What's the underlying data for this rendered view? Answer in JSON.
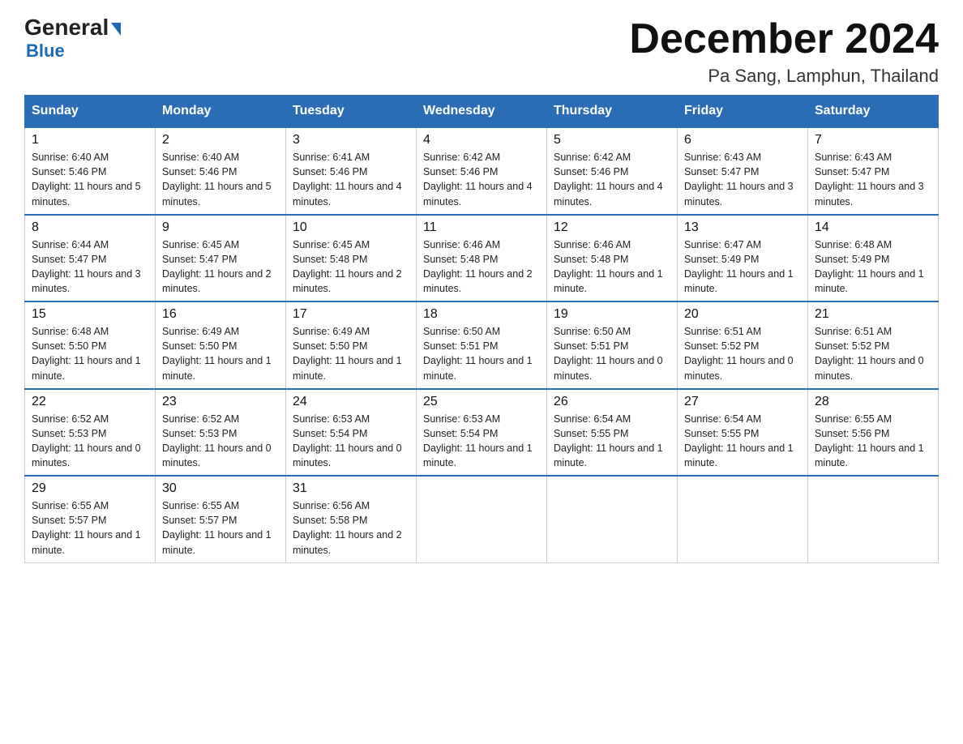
{
  "logo": {
    "general": "General",
    "blue": "Blue",
    "arrow": "▶"
  },
  "header": {
    "month": "December 2024",
    "location": "Pa Sang, Lamphun, Thailand"
  },
  "days": [
    "Sunday",
    "Monday",
    "Tuesday",
    "Wednesday",
    "Thursday",
    "Friday",
    "Saturday"
  ],
  "weeks": [
    [
      {
        "num": "1",
        "sunrise": "6:40 AM",
        "sunset": "5:46 PM",
        "daylight": "11 hours and 5 minutes."
      },
      {
        "num": "2",
        "sunrise": "6:40 AM",
        "sunset": "5:46 PM",
        "daylight": "11 hours and 5 minutes."
      },
      {
        "num": "3",
        "sunrise": "6:41 AM",
        "sunset": "5:46 PM",
        "daylight": "11 hours and 4 minutes."
      },
      {
        "num": "4",
        "sunrise": "6:42 AM",
        "sunset": "5:46 PM",
        "daylight": "11 hours and 4 minutes."
      },
      {
        "num": "5",
        "sunrise": "6:42 AM",
        "sunset": "5:46 PM",
        "daylight": "11 hours and 4 minutes."
      },
      {
        "num": "6",
        "sunrise": "6:43 AM",
        "sunset": "5:47 PM",
        "daylight": "11 hours and 3 minutes."
      },
      {
        "num": "7",
        "sunrise": "6:43 AM",
        "sunset": "5:47 PM",
        "daylight": "11 hours and 3 minutes."
      }
    ],
    [
      {
        "num": "8",
        "sunrise": "6:44 AM",
        "sunset": "5:47 PM",
        "daylight": "11 hours and 3 minutes."
      },
      {
        "num": "9",
        "sunrise": "6:45 AM",
        "sunset": "5:47 PM",
        "daylight": "11 hours and 2 minutes."
      },
      {
        "num": "10",
        "sunrise": "6:45 AM",
        "sunset": "5:48 PM",
        "daylight": "11 hours and 2 minutes."
      },
      {
        "num": "11",
        "sunrise": "6:46 AM",
        "sunset": "5:48 PM",
        "daylight": "11 hours and 2 minutes."
      },
      {
        "num": "12",
        "sunrise": "6:46 AM",
        "sunset": "5:48 PM",
        "daylight": "11 hours and 1 minute."
      },
      {
        "num": "13",
        "sunrise": "6:47 AM",
        "sunset": "5:49 PM",
        "daylight": "11 hours and 1 minute."
      },
      {
        "num": "14",
        "sunrise": "6:48 AM",
        "sunset": "5:49 PM",
        "daylight": "11 hours and 1 minute."
      }
    ],
    [
      {
        "num": "15",
        "sunrise": "6:48 AM",
        "sunset": "5:50 PM",
        "daylight": "11 hours and 1 minute."
      },
      {
        "num": "16",
        "sunrise": "6:49 AM",
        "sunset": "5:50 PM",
        "daylight": "11 hours and 1 minute."
      },
      {
        "num": "17",
        "sunrise": "6:49 AM",
        "sunset": "5:50 PM",
        "daylight": "11 hours and 1 minute."
      },
      {
        "num": "18",
        "sunrise": "6:50 AM",
        "sunset": "5:51 PM",
        "daylight": "11 hours and 1 minute."
      },
      {
        "num": "19",
        "sunrise": "6:50 AM",
        "sunset": "5:51 PM",
        "daylight": "11 hours and 0 minutes."
      },
      {
        "num": "20",
        "sunrise": "6:51 AM",
        "sunset": "5:52 PM",
        "daylight": "11 hours and 0 minutes."
      },
      {
        "num": "21",
        "sunrise": "6:51 AM",
        "sunset": "5:52 PM",
        "daylight": "11 hours and 0 minutes."
      }
    ],
    [
      {
        "num": "22",
        "sunrise": "6:52 AM",
        "sunset": "5:53 PM",
        "daylight": "11 hours and 0 minutes."
      },
      {
        "num": "23",
        "sunrise": "6:52 AM",
        "sunset": "5:53 PM",
        "daylight": "11 hours and 0 minutes."
      },
      {
        "num": "24",
        "sunrise": "6:53 AM",
        "sunset": "5:54 PM",
        "daylight": "11 hours and 0 minutes."
      },
      {
        "num": "25",
        "sunrise": "6:53 AM",
        "sunset": "5:54 PM",
        "daylight": "11 hours and 1 minute."
      },
      {
        "num": "26",
        "sunrise": "6:54 AM",
        "sunset": "5:55 PM",
        "daylight": "11 hours and 1 minute."
      },
      {
        "num": "27",
        "sunrise": "6:54 AM",
        "sunset": "5:55 PM",
        "daylight": "11 hours and 1 minute."
      },
      {
        "num": "28",
        "sunrise": "6:55 AM",
        "sunset": "5:56 PM",
        "daylight": "11 hours and 1 minute."
      }
    ],
    [
      {
        "num": "29",
        "sunrise": "6:55 AM",
        "sunset": "5:57 PM",
        "daylight": "11 hours and 1 minute."
      },
      {
        "num": "30",
        "sunrise": "6:55 AM",
        "sunset": "5:57 PM",
        "daylight": "11 hours and 1 minute."
      },
      {
        "num": "31",
        "sunrise": "6:56 AM",
        "sunset": "5:58 PM",
        "daylight": "11 hours and 2 minutes."
      },
      null,
      null,
      null,
      null
    ]
  ]
}
